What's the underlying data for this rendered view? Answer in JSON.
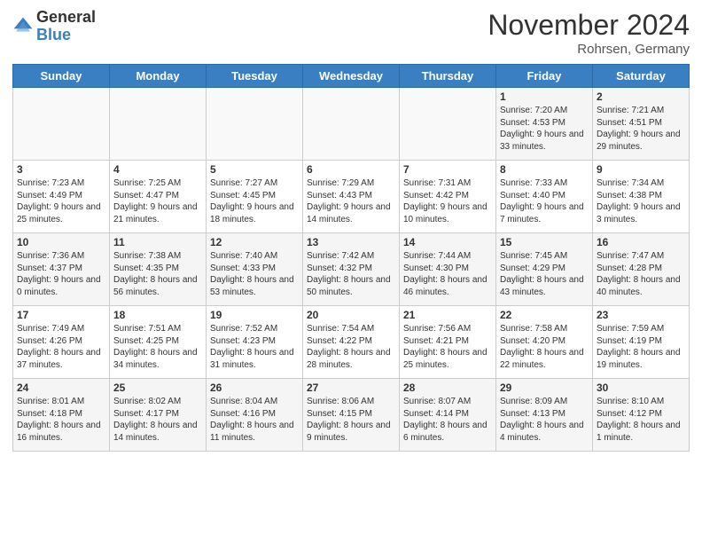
{
  "logo": {
    "general": "General",
    "blue": "Blue"
  },
  "title": "November 2024",
  "subtitle": "Rohrsen, Germany",
  "days_of_week": [
    "Sunday",
    "Monday",
    "Tuesday",
    "Wednesday",
    "Thursday",
    "Friday",
    "Saturday"
  ],
  "weeks": [
    [
      {
        "day": "",
        "info": ""
      },
      {
        "day": "",
        "info": ""
      },
      {
        "day": "",
        "info": ""
      },
      {
        "day": "",
        "info": ""
      },
      {
        "day": "",
        "info": ""
      },
      {
        "day": "1",
        "info": "Sunrise: 7:20 AM\nSunset: 4:53 PM\nDaylight: 9 hours and 33 minutes."
      },
      {
        "day": "2",
        "info": "Sunrise: 7:21 AM\nSunset: 4:51 PM\nDaylight: 9 hours and 29 minutes."
      }
    ],
    [
      {
        "day": "3",
        "info": "Sunrise: 7:23 AM\nSunset: 4:49 PM\nDaylight: 9 hours and 25 minutes."
      },
      {
        "day": "4",
        "info": "Sunrise: 7:25 AM\nSunset: 4:47 PM\nDaylight: 9 hours and 21 minutes."
      },
      {
        "day": "5",
        "info": "Sunrise: 7:27 AM\nSunset: 4:45 PM\nDaylight: 9 hours and 18 minutes."
      },
      {
        "day": "6",
        "info": "Sunrise: 7:29 AM\nSunset: 4:43 PM\nDaylight: 9 hours and 14 minutes."
      },
      {
        "day": "7",
        "info": "Sunrise: 7:31 AM\nSunset: 4:42 PM\nDaylight: 9 hours and 10 minutes."
      },
      {
        "day": "8",
        "info": "Sunrise: 7:33 AM\nSunset: 4:40 PM\nDaylight: 9 hours and 7 minutes."
      },
      {
        "day": "9",
        "info": "Sunrise: 7:34 AM\nSunset: 4:38 PM\nDaylight: 9 hours and 3 minutes."
      }
    ],
    [
      {
        "day": "10",
        "info": "Sunrise: 7:36 AM\nSunset: 4:37 PM\nDaylight: 9 hours and 0 minutes."
      },
      {
        "day": "11",
        "info": "Sunrise: 7:38 AM\nSunset: 4:35 PM\nDaylight: 8 hours and 56 minutes."
      },
      {
        "day": "12",
        "info": "Sunrise: 7:40 AM\nSunset: 4:33 PM\nDaylight: 8 hours and 53 minutes."
      },
      {
        "day": "13",
        "info": "Sunrise: 7:42 AM\nSunset: 4:32 PM\nDaylight: 8 hours and 50 minutes."
      },
      {
        "day": "14",
        "info": "Sunrise: 7:44 AM\nSunset: 4:30 PM\nDaylight: 8 hours and 46 minutes."
      },
      {
        "day": "15",
        "info": "Sunrise: 7:45 AM\nSunset: 4:29 PM\nDaylight: 8 hours and 43 minutes."
      },
      {
        "day": "16",
        "info": "Sunrise: 7:47 AM\nSunset: 4:28 PM\nDaylight: 8 hours and 40 minutes."
      }
    ],
    [
      {
        "day": "17",
        "info": "Sunrise: 7:49 AM\nSunset: 4:26 PM\nDaylight: 8 hours and 37 minutes."
      },
      {
        "day": "18",
        "info": "Sunrise: 7:51 AM\nSunset: 4:25 PM\nDaylight: 8 hours and 34 minutes."
      },
      {
        "day": "19",
        "info": "Sunrise: 7:52 AM\nSunset: 4:23 PM\nDaylight: 8 hours and 31 minutes."
      },
      {
        "day": "20",
        "info": "Sunrise: 7:54 AM\nSunset: 4:22 PM\nDaylight: 8 hours and 28 minutes."
      },
      {
        "day": "21",
        "info": "Sunrise: 7:56 AM\nSunset: 4:21 PM\nDaylight: 8 hours and 25 minutes."
      },
      {
        "day": "22",
        "info": "Sunrise: 7:58 AM\nSunset: 4:20 PM\nDaylight: 8 hours and 22 minutes."
      },
      {
        "day": "23",
        "info": "Sunrise: 7:59 AM\nSunset: 4:19 PM\nDaylight: 8 hours and 19 minutes."
      }
    ],
    [
      {
        "day": "24",
        "info": "Sunrise: 8:01 AM\nSunset: 4:18 PM\nDaylight: 8 hours and 16 minutes."
      },
      {
        "day": "25",
        "info": "Sunrise: 8:02 AM\nSunset: 4:17 PM\nDaylight: 8 hours and 14 minutes."
      },
      {
        "day": "26",
        "info": "Sunrise: 8:04 AM\nSunset: 4:16 PM\nDaylight: 8 hours and 11 minutes."
      },
      {
        "day": "27",
        "info": "Sunrise: 8:06 AM\nSunset: 4:15 PM\nDaylight: 8 hours and 9 minutes."
      },
      {
        "day": "28",
        "info": "Sunrise: 8:07 AM\nSunset: 4:14 PM\nDaylight: 8 hours and 6 minutes."
      },
      {
        "day": "29",
        "info": "Sunrise: 8:09 AM\nSunset: 4:13 PM\nDaylight: 8 hours and 4 minutes."
      },
      {
        "day": "30",
        "info": "Sunrise: 8:10 AM\nSunset: 4:12 PM\nDaylight: 8 hours and 1 minute."
      }
    ]
  ]
}
